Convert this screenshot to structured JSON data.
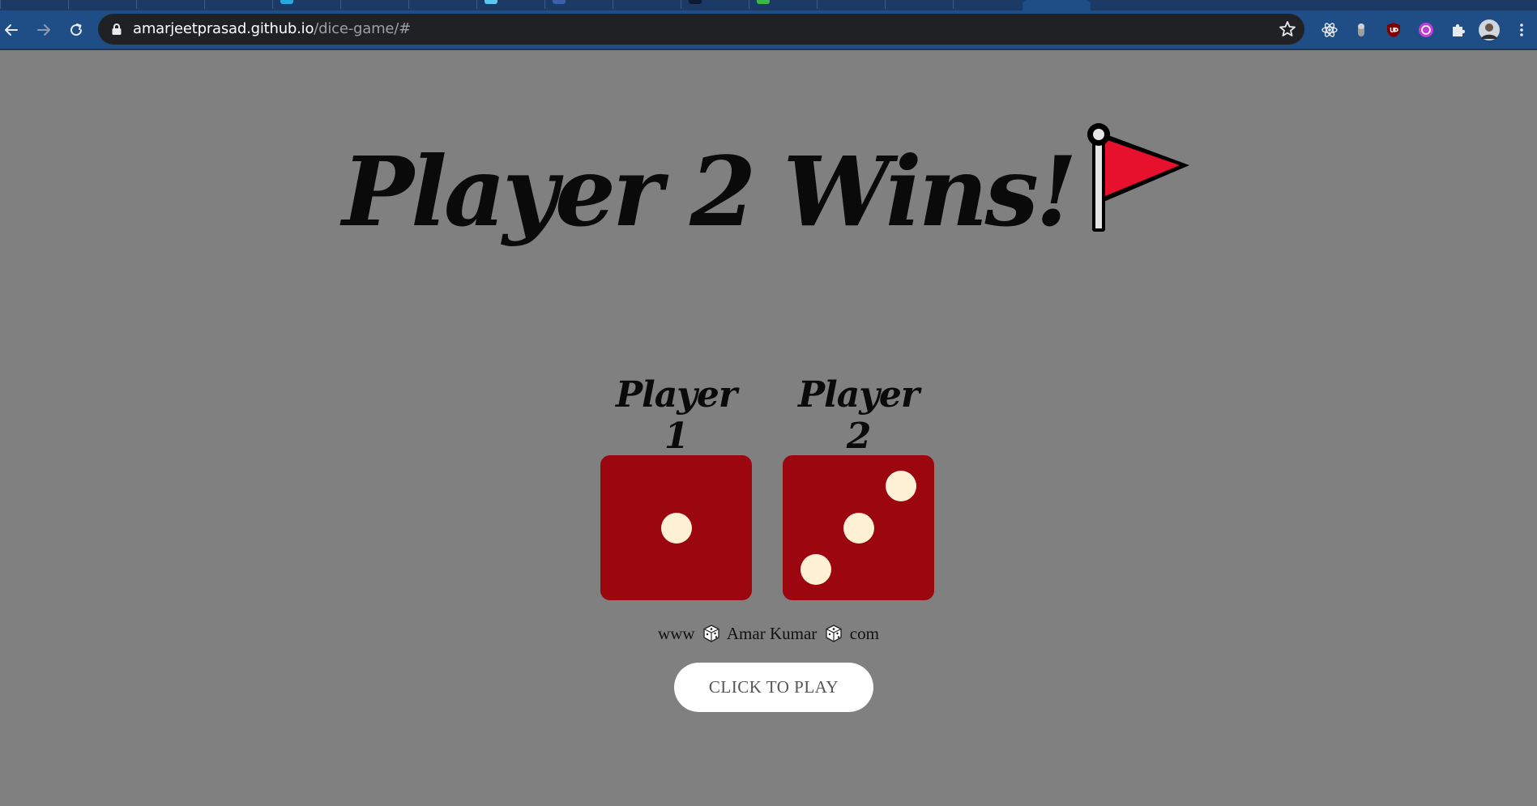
{
  "browser": {
    "url_host": "amarjeetprasad.github.io",
    "url_path": "/dice-game/#"
  },
  "game": {
    "headline": "Player 2 Wins!",
    "players": [
      {
        "label": "Player 1",
        "die_value": 1
      },
      {
        "label": "Player 2",
        "die_value": 3
      }
    ],
    "credit_left": "www",
    "credit_middle": "Amar Kumar",
    "credit_right": "com",
    "play_button_label": "CLICK TO PLAY"
  },
  "colors": {
    "page_background": "#808080",
    "die_face": "#9b060f",
    "die_pip": "#fdf0d5",
    "flag": "#e8112d",
    "browser_toolbar": "#1f4d86"
  }
}
